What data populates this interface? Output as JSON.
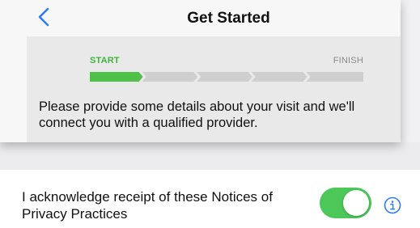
{
  "nav": {
    "title": "Get Started",
    "back_icon": "chevron-left-icon"
  },
  "progress": {
    "start_label": "START",
    "finish_label": "FINISH",
    "total_steps": 5,
    "completed_steps": 1
  },
  "intro": {
    "text": "Please provide some details about your visit and we'll connect you with a qualified provider."
  },
  "acknowledgement": {
    "label": "I acknowledge receipt of these Notices of Privacy Practices",
    "toggle_on": true,
    "info_icon": "info-icon"
  },
  "colors": {
    "accent_blue": "#2f7cf6",
    "progress_green": "#4fc04a",
    "progress_gray": "#cfcfcf",
    "toggle_green": "#4cc859"
  }
}
